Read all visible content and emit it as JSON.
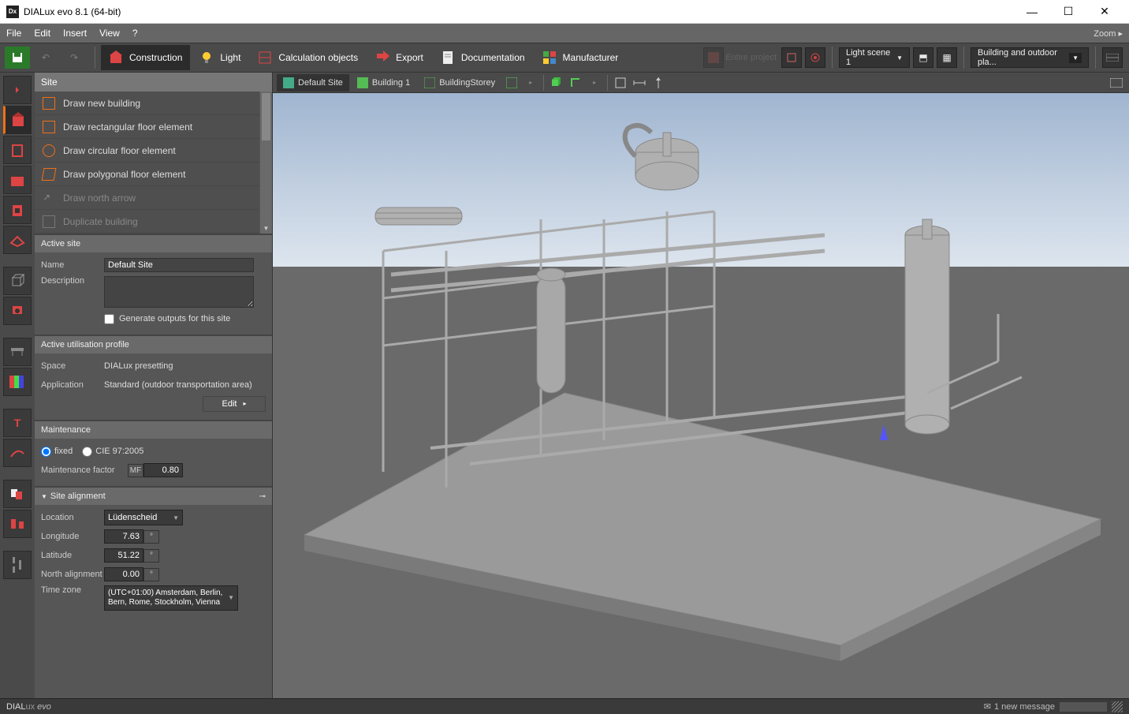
{
  "window": {
    "title": "DIALux evo 8.1  (64-bit)"
  },
  "menubar": {
    "items": [
      "File",
      "Edit",
      "Insert",
      "View",
      "?"
    ],
    "zoom": "Zoom ▸"
  },
  "modes": {
    "items": [
      "Construction",
      "Light",
      "Calculation objects",
      "Export",
      "Documentation",
      "Manufacturer"
    ],
    "active": 0
  },
  "topright": {
    "entire_project": "Entire project",
    "light_scene": "Light scene 1",
    "view_combo": "Building and outdoor pla..."
  },
  "breadcrumb": {
    "items": [
      "Default Site",
      "Building 1",
      "BuildingStorey"
    ],
    "active": 0
  },
  "site_header": "Site",
  "draw_tools": [
    {
      "label": "Draw new building",
      "enabled": true,
      "shape": "rect"
    },
    {
      "label": "Draw rectangular floor element",
      "enabled": true,
      "shape": "rect"
    },
    {
      "label": "Draw circular floor element",
      "enabled": true,
      "shape": "circle"
    },
    {
      "label": "Draw polygonal floor element",
      "enabled": true,
      "shape": "poly"
    },
    {
      "label": "Draw north arrow",
      "enabled": false,
      "shape": "arrow"
    },
    {
      "label": "Duplicate building",
      "enabled": false,
      "shape": "dup"
    }
  ],
  "active_site": {
    "header": "Active site",
    "name_label": "Name",
    "name_value": "Default Site",
    "desc_label": "Description",
    "desc_value": "",
    "gen_outputs": "Generate outputs for this site"
  },
  "profile": {
    "header": "Active utilisation profile",
    "space_label": "Space",
    "space_value": "DIALux presetting",
    "app_label": "Application",
    "app_value": "Standard (outdoor transportation area)",
    "edit": "Edit"
  },
  "maintenance": {
    "header": "Maintenance",
    "fixed": "fixed",
    "cie": "CIE 97:2005",
    "mf_label": "Maintenance factor",
    "mf_unit": "MF",
    "mf_value": "0.80"
  },
  "alignment": {
    "header": "Site alignment",
    "location_label": "Location",
    "location_value": "Lüdenscheid",
    "lon_label": "Longitude",
    "lon_value": "7.63",
    "lat_label": "Latitude",
    "lat_value": "51.22",
    "north_label": "North alignment",
    "north_value": "0.00",
    "tz_label": "Time zone",
    "tz_value": "(UTC+01:00) Amsterdam, Berlin, Bern, Rome, Stockholm, Vienna"
  },
  "status": {
    "brand": "DIALux evo",
    "msg_count": "1 new message",
    "env_icon": "✉"
  }
}
